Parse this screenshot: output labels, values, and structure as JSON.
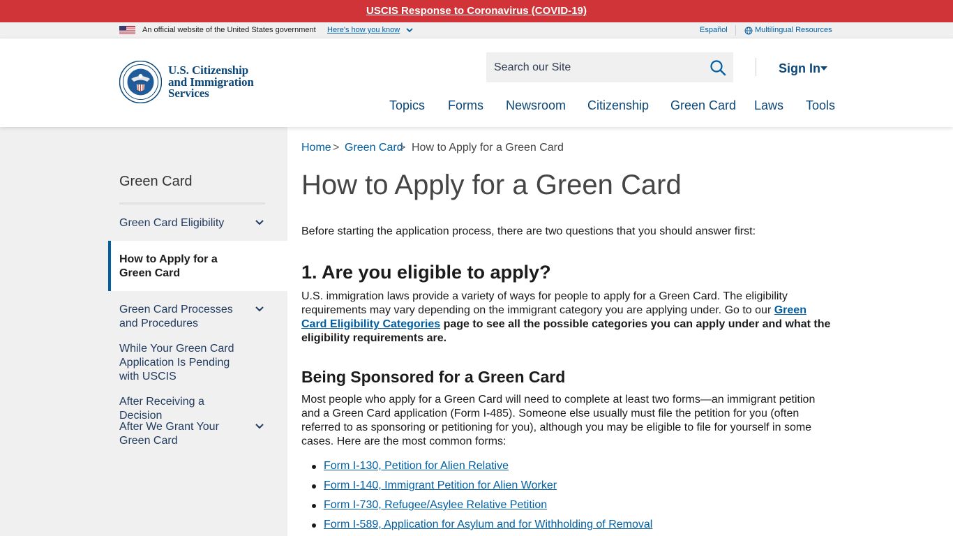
{
  "alert": {
    "text": "USCIS Response to Coronavirus (COVID-19)"
  },
  "gov_banner": {
    "official_text": "An official website of the United States government",
    "how_link": "Here's how you know",
    "espanol": "Español",
    "multilingual": "Multilingual Resources"
  },
  "header": {
    "logo_lines": [
      "U.S. Citizenship",
      "and Immigration",
      "Services"
    ],
    "search_placeholder": "Search our Site",
    "sign_in": "Sign In",
    "nav": [
      "Topics",
      "Forms",
      "Newsroom",
      "Citizenship",
      "Green Card",
      "Laws",
      "Tools"
    ]
  },
  "sidebar": {
    "title": "Green Card",
    "items": [
      {
        "label": "Green Card Eligibility",
        "expandable": true
      },
      {
        "label": "How to Apply for a Green Card",
        "active": true
      },
      {
        "label": "Green Card Processes and Procedures",
        "expandable": true
      },
      {
        "label": "While Your Green Card Application Is Pending with USCIS"
      },
      {
        "label": "After Receiving a Decision"
      },
      {
        "label": "After We Grant Your Green Card",
        "expandable": true
      }
    ]
  },
  "breadcrumb": {
    "items": [
      "Home",
      "Green Card"
    ],
    "current": "How to Apply for a Green Card",
    "separator": ">"
  },
  "main": {
    "title": "How to Apply for a Green Card",
    "intro": "Before starting the application process, there are two questions that you should answer first:",
    "section1_heading": "1. Are you eligible to apply?",
    "section1_text_a": "U.S. immigration laws provide a variety of ways for people to apply for a Green Card. The eligibility requirements may vary depending on the immigrant category you are applying under. Go to our ",
    "section1_link": "Green Card Eligibility Categories",
    "section1_text_b": " page to see all the possible categories you can apply under and what the eligibility requirements are.",
    "section2_heading": "Being Sponsored for a Green Card",
    "section2_text": "Most people who apply for a Green Card will need to complete at least two forms—an immigrant petition and a Green Card application (Form I-485). Someone else usually must file the petition for you (often referred to as sponsoring or petitioning for you), although you may be eligible to file for yourself in some cases. Here are the most common forms:",
    "forms": [
      "Form I-130, Petition for Alien Relative",
      "Form I-140, Immigrant Petition for Alien Worker",
      "Form I-730, Refugee/Asylee Relative Petition",
      "Form I-589, Application for Asylum and for Withholding of Removal"
    ]
  },
  "colors": {
    "alert_bg": "#d13438",
    "brand_navy": "#0b4778",
    "link_blue": "#005ea2",
    "sidebar_bg": "#f0f0f0"
  },
  "icons": [
    "us-flag-icon",
    "chevron-down-icon",
    "globe-icon",
    "dhs-seal-logo",
    "search-icon",
    "caret-down-icon"
  ]
}
